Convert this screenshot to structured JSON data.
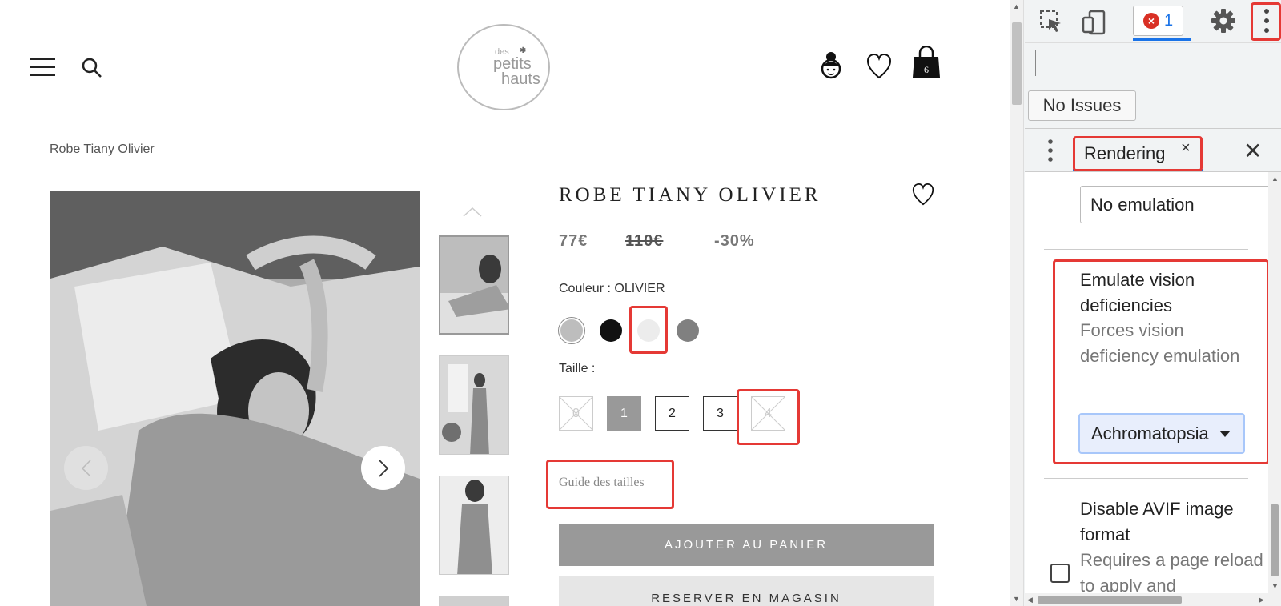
{
  "site": {
    "breadcrumb": "Robe Tiany Olivier",
    "logo_text": {
      "line1": "des",
      "line2": "petits",
      "line3": "hauts"
    },
    "cart_count": "6",
    "product": {
      "title": "ROBE TIANY OLIVIER",
      "price_current": "77€",
      "price_old": "110€",
      "discount": "-30%",
      "color_label": "Couleur : OLIVIER",
      "size_label": "Taille :",
      "sizes": [
        {
          "label": "0",
          "state": "unavailable"
        },
        {
          "label": "1",
          "state": "selected"
        },
        {
          "label": "2",
          "state": "available"
        },
        {
          "label": "3",
          "state": "available"
        },
        {
          "label": "4",
          "state": "unavailable"
        }
      ],
      "swatch_colors": [
        "#bdbdbd",
        "#111111",
        "#ececec",
        "#808080"
      ],
      "size_guide": "Guide des tailles",
      "add_to_cart": "AJOUTER AU PANIER",
      "reserve": "RESERVER EN MAGASIN"
    }
  },
  "devtools": {
    "error_count": "1",
    "error_mark": "×",
    "no_issues": "No Issues",
    "drawer_tab": "Rendering",
    "tab_close": "×",
    "drawer_close": "✕",
    "emulation_value": "No emulation",
    "vision": {
      "title": "Emulate vision deficiencies",
      "desc": "Forces vision deficiency emulation",
      "value": "Achromatopsia"
    },
    "avif": {
      "title": "Disable AVIF image format",
      "desc": "Requires a page reload to apply and"
    }
  },
  "colors": {
    "highlight": "#e53935",
    "accent": "#1a73e8"
  }
}
